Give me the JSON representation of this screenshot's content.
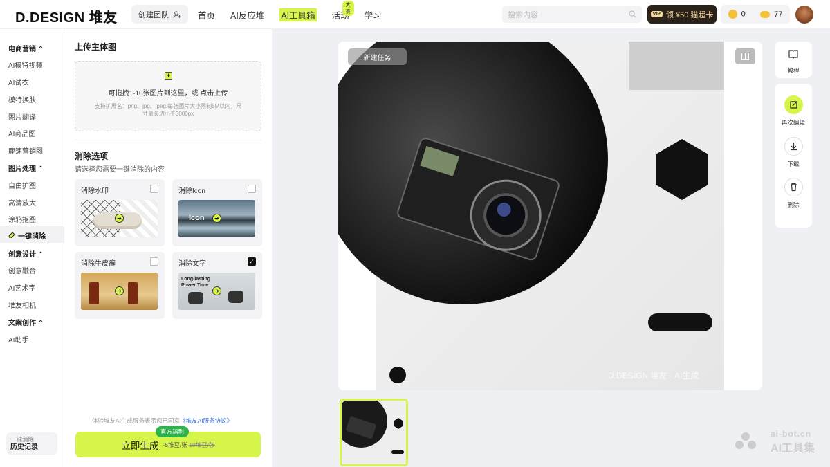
{
  "header": {
    "logo": "D.DESIGN 堆友",
    "create_team": "创建团队",
    "nav": [
      "首页",
      "AI反应堆",
      "AI工具箱",
      "活动",
      "学习"
    ],
    "activity_badge": "大赛",
    "search_placeholder": "搜索内容",
    "vip_tag": "VIP",
    "vip_label": "领 ¥50 猫超卡",
    "coin_count": "0",
    "bean_count": "77"
  },
  "sidebar": {
    "sections": [
      {
        "title": "电商营销",
        "items": [
          "AI模特视频",
          "AI试衣",
          "模特换肤",
          "图片翻译",
          "AI商品图",
          "鹿速营销图"
        ]
      },
      {
        "title": "图片处理",
        "items": [
          "自由扩图",
          "高清放大",
          "涂鸦抠图",
          "一键消除"
        ]
      },
      {
        "title": "创意设计",
        "items": [
          "创意融合",
          "AI艺术字",
          "堆友相机"
        ]
      },
      {
        "title": "文案创作",
        "items": [
          "AI助手"
        ]
      }
    ],
    "active_item": "一键消除",
    "history_caption": "一键消除",
    "history_label": "历史记录"
  },
  "panel": {
    "upload_title": "上传主体图",
    "upload_main": "可拖拽1-10张图片到这里，或 点击上传",
    "upload_hint": "支持扩展名：png、jpg、jpeg,每张图片大小限制5M以内，尺寸最长边小于3000px",
    "options_title": "消除选项",
    "options_sub": "请选择您需要一键消除的内容",
    "options": [
      {
        "label": "消除水印",
        "checked": false
      },
      {
        "label": "消除Icon",
        "checked": false,
        "image_text": "Icon"
      },
      {
        "label": "消除牛皮癣",
        "checked": false
      },
      {
        "label": "消除文字",
        "checked": true,
        "image_text": "Long-lasting Power Time"
      }
    ],
    "agreement_prefix": "体验堆友AI生成服务表示您已同意",
    "agreement_link": "《堆友AI服务协议》",
    "generate_label": "立即生成",
    "generate_price": "-5堆豆/张",
    "generate_old_price": "10堆豆/张",
    "generate_tag": "官方福利"
  },
  "canvas": {
    "new_task": "新建任务",
    "watermark": "D.DESIGN 堆友 · AI生成"
  },
  "tools": {
    "tutorial": "教程",
    "reedit": "再次编辑",
    "download": "下载",
    "delete": "删除"
  },
  "site_watermark": {
    "line1": "ai-bot.cn",
    "line2": "AI工具集"
  },
  "colors": {
    "accent": "#d6f54a",
    "vip_bg": "#2a2218",
    "canvas_bg": "#eff0f3"
  }
}
